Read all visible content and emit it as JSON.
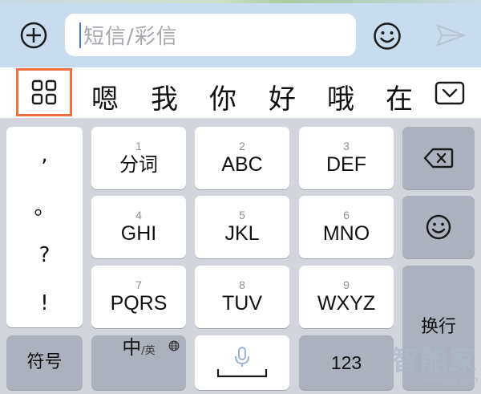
{
  "compose": {
    "placeholder": "短信/彩信",
    "icons": [
      "add-icon",
      "emoji-icon",
      "send-icon"
    ]
  },
  "candidates": {
    "items": [
      "嗯",
      "我",
      "你",
      "好",
      "哦",
      "在"
    ],
    "icons": [
      "grid-icon",
      "chevron-down-icon"
    ],
    "highlight_color": "#f07040"
  },
  "keyboard": {
    "punctuation": [
      ",",
      "。",
      "?",
      "!"
    ],
    "keys": [
      {
        "num": "1",
        "label": "分词"
      },
      {
        "num": "2",
        "label": "ABC"
      },
      {
        "num": "3",
        "label": "DEF"
      },
      {
        "num": "4",
        "label": "GHI"
      },
      {
        "num": "5",
        "label": "JKL"
      },
      {
        "num": "6",
        "label": "MNO"
      },
      {
        "num": "7",
        "label": "PQRS"
      },
      {
        "num": "8",
        "label": "TUV"
      },
      {
        "num": "9",
        "label": "WXYZ"
      }
    ],
    "symbols_label": "符号",
    "lang_label": "中",
    "lang_sub": "/英",
    "numbers_label": "123",
    "enter_label": "换行",
    "icons": [
      "backspace-icon",
      "emoji-icon",
      "globe-icon",
      "microphone-icon"
    ]
  },
  "watermark": {
    "text": "智能家",
    "url": "www.znj.com"
  },
  "colors": {
    "compose_bg": "#c8dcee",
    "keyboard_bg": "#d2d5db",
    "function_key": "#acb2bd",
    "caret": "#3b7bd8"
  }
}
